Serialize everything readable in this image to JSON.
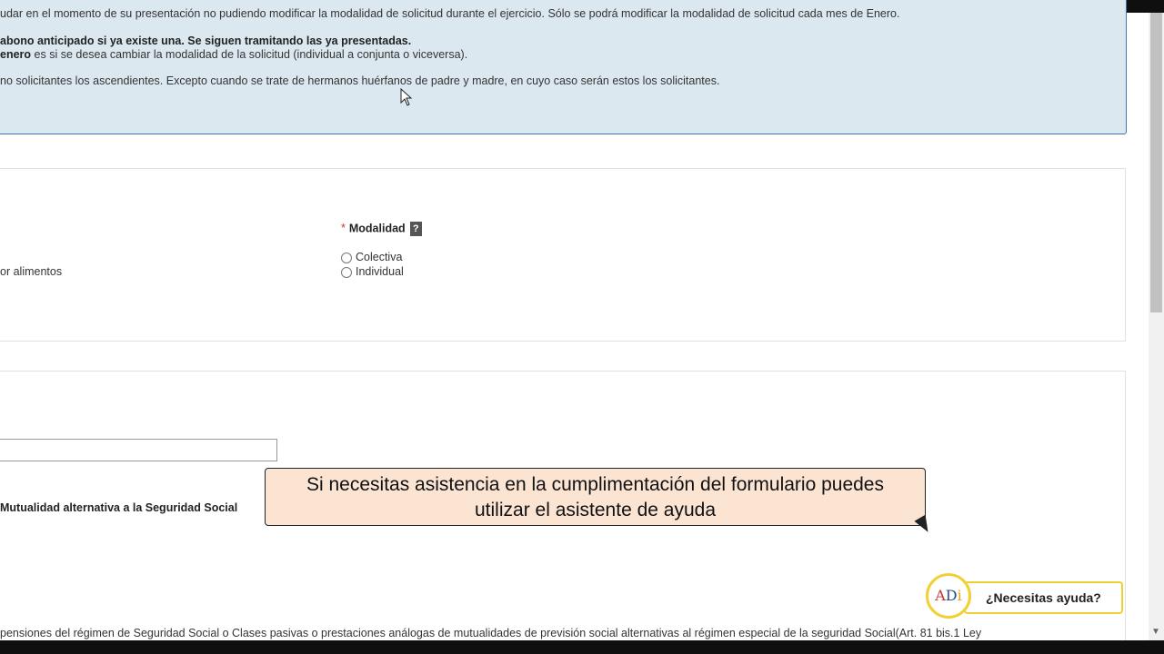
{
  "info": {
    "line_cut": "udar en el momento de su presentación no pudiendo modificar la modalidad de solicitud durante el ejercicio. Sólo se podrá modificar la modalidad de solicitud cada mes de Enero.",
    "line1": "abono anticipado si ya existe una. Se siguen tramitando las ya presentadas.",
    "line2_bold": "enero",
    "line2_rest": " es si se desea cambiar la modalidad de la solicitud (individual a conjunta o viceversa).",
    "line3": "no solicitantes los ascendientes. Excepto cuando se trate de hermanos huérfanos de padre y madre, en cuyo caso serán estos los solicitantes."
  },
  "form": {
    "modalidad_label": "Modalidad",
    "help_glyph": "?",
    "option_colectiva": "Colectiva",
    "option_individual": "Individual",
    "left_label": "or alimentos",
    "mutualidad_label": "Mutualidad alternativa a la Seguridad Social",
    "bottom_text": "pensiones del régimen de Seguridad Social o Clases pasivas o prestaciones análogas de mutualidades de previsión social alternativas al régimen especial de la seguridad Social(Art. 81 bis.1 Ley"
  },
  "tooltip": {
    "line1": "Si necesitas asistencia en la cumplimentación del formulario puedes",
    "line2": "utilizar el asistente de ayuda"
  },
  "help_widget": {
    "label": "¿Necesitas ayuda?",
    "logo_a": "A",
    "logo_d": "D",
    "logo_i": "i"
  },
  "colors": {
    "info_bg": "#dce8f0",
    "info_border": "#3c76b2",
    "tooltip_bg": "#fce4d3",
    "help_border": "#f0d033"
  }
}
